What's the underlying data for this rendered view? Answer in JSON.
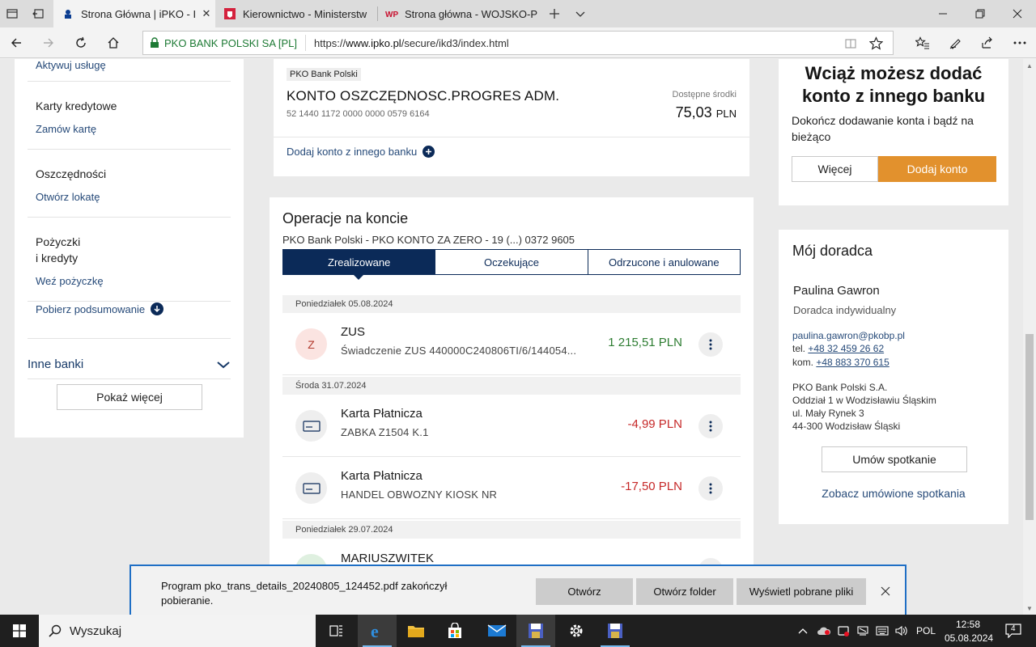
{
  "browser": {
    "tabs": [
      {
        "title": "Strona Główna | iPKO - I",
        "active": true
      },
      {
        "title": "Kierownictwo - Ministerstw",
        "active": false
      },
      {
        "title": "Strona główna - WOJSKO-P",
        "active": false
      }
    ],
    "certificate": "PKO BANK POLSKI SA [PL]",
    "url_prefix": "https://",
    "url_domain": "www.ipko.pl",
    "url_path": "/secure/ikd3/index.html"
  },
  "menu": {
    "top_link": "Aktywuj usługę",
    "sections": [
      {
        "title": "Karty kredytowe",
        "link": "Zamów kartę"
      },
      {
        "title": "Oszczędności",
        "link": "Otwórz lokatę"
      },
      {
        "title_l1": "Pożyczki",
        "title_l2": "i kredyty",
        "link": "Weź pożyczkę"
      }
    ],
    "summary": "Pobierz podsumowanie",
    "other_banks": "Inne banki",
    "show_more": "Pokaż więcej"
  },
  "account": {
    "bank_badge": "PKO Bank Polski",
    "name": "KONTO OSZCZĘDNOSC.PROGRES ADM.",
    "number": "52 1440 1172 0000 0000 0579 6164",
    "available_label": "Dostępne środki",
    "available_amount": "75,03",
    "currency": "PLN",
    "add_account": "Dodaj konto z innego banku"
  },
  "operations": {
    "title": "Operacje na koncie",
    "subtitle": "PKO Bank Polski - PKO KONTO ZA ZERO - 19 (...) 0372 9605",
    "tabs": [
      "Zrealizowane",
      "Oczekujące",
      "Odrzucone i anulowane"
    ],
    "dates": [
      "Poniedziałek 05.08.2024",
      "Środa 31.07.2024",
      "Poniedziałek 29.07.2024"
    ],
    "transactions": [
      {
        "avatar": "Z",
        "title": "ZUS",
        "desc": "Świadczenie ZUS 440000C240806TI/6/144054...",
        "amount": "1 215,51 PLN",
        "kind": "positive"
      },
      {
        "avatar": "",
        "title": "Karta Płatnicza",
        "desc": "ZABKA Z1504 K.1",
        "amount": "-4,99 PLN",
        "kind": "negative"
      },
      {
        "avatar": "",
        "title": "Karta Płatnicza",
        "desc": "HANDEL OBWOZNY KIOSK NR",
        "amount": "-17,50 PLN",
        "kind": "negative"
      },
      {
        "avatar": "",
        "title": "MARIUSZWITEK",
        "desc": "",
        "amount": "",
        "kind": "positive"
      }
    ]
  },
  "promo": {
    "heading_l1": "Wciąż możesz dodać",
    "heading_l2": "konto z innego banku",
    "text": "Dokończ dodawanie konta i bądź na bieżąco",
    "more_button": "Więcej",
    "add_button": "Dodaj konto"
  },
  "advisor": {
    "heading": "Mój doradca",
    "name": "Paulina Gawron",
    "role": "Doradca indywidualny",
    "email": "paulina.gawron@pkobp.pl",
    "tel_label": "tel.",
    "tel": "+48 32 459 26 62",
    "mobile_label": "kom.",
    "mobile": "+48 883 370 615",
    "address": [
      "PKO Bank Polski S.A.",
      "Oddział 1 w Wodzisławiu Śląskim",
      "ul. Mały Rynek 3",
      "44-300 Wodzisław Śląski"
    ],
    "meeting_button": "Umów spotkanie",
    "meetings_link": "Zobacz umówione spotkania"
  },
  "download": {
    "message": "Program pko_trans_details_20240805_124452.pdf zakończył pobieranie.",
    "open": "Otwórz",
    "open_folder": "Otwórz folder",
    "show_downloads": "Wyświetl pobrane pliki"
  },
  "taskbar": {
    "search_placeholder": "Wyszukaj",
    "language": "POL",
    "time": "12:58",
    "date": "05.08.2024",
    "notifications": "4"
  },
  "colors": {
    "navy": "#0b2a58",
    "orange": "#e2912d",
    "positive": "#2e7d32",
    "negative": "#c62828"
  }
}
